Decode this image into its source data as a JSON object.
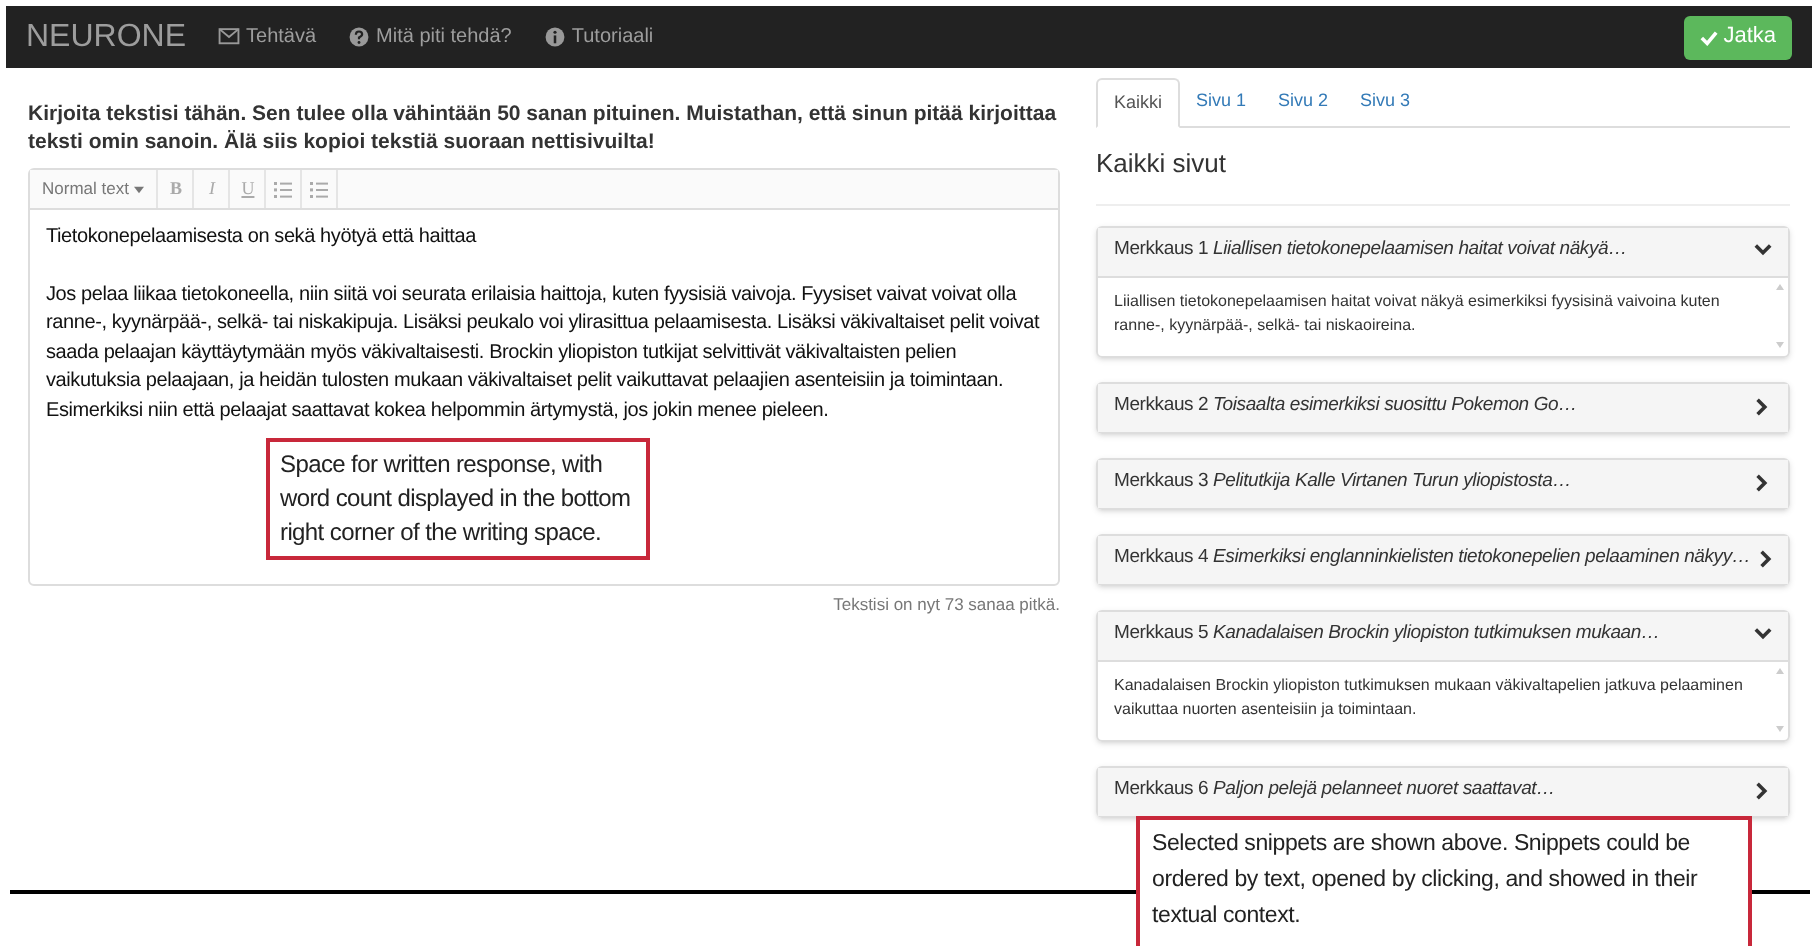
{
  "navbar": {
    "brand": "NEURONE",
    "links": [
      {
        "label": "Tehtävä"
      },
      {
        "label": "Mitä piti tehdä?"
      },
      {
        "label": "Tutoriaali"
      }
    ],
    "continue_button": "Jatka"
  },
  "instructions": "Kirjoita tekstisi tähän. Sen tulee olla vähintään 50 sanan pituinen. Muistathan, että sinun pitää kirjoittaa teksti omin sanoin. Älä siis kopioi tekstiä suoraan nettisivuilta!",
  "editor": {
    "toolbar": {
      "style_select": "Normal text",
      "buttons": [
        "B",
        "I",
        "U"
      ]
    },
    "paragraphs": [
      "Tietokonepelaamisesta on sekä hyötyä että haittaa",
      "Jos pelaa liikaa tietokoneella, niin siitä voi seurata erilaisia haittoja, kuten fyysisiä vaivoja. Fyysiset vaivat voivat olla ranne-, kyynärpää-, selkä- tai niskakipuja. Lisäksi peukalo voi ylirasittua pelaamisesta. Lisäksi väkivaltaiset pelit voivat saada pelaajan käyttäytymään myös väkivaltaisesti. Brockin yliopiston tutkijat selvittivät väkivaltaisten pelien vaikutuksia pelaajaan, ja heidän tulosten mukaan väkivaltaiset pelit vaikuttavat pelaajien asenteisiin ja toimintaan. Esimerkiksi niin että pelaajat saattavat kokea helpommin ärtymystä, jos jokin menee pieleen."
    ],
    "word_count": "Tekstisi on nyt 73 sanaa pitkä."
  },
  "callout_left": "Space for written response, with word count displayed in the bottom right corner of the writing space.",
  "tabs": [
    {
      "label": "Kaikki",
      "selected": true
    },
    {
      "label": "Sivu 1",
      "selected": false
    },
    {
      "label": "Sivu 2",
      "selected": false
    },
    {
      "label": "Sivu 3",
      "selected": false
    }
  ],
  "section_title": "Kaikki sivut",
  "snippets": [
    {
      "label": "Merkkaus 1",
      "title": "Liiallisen tietokonepelaamisen haitat voivat näkyä…",
      "expanded": true,
      "body": "Liiallisen tietokonepelaamisen haitat voivat näkyä esimerkiksi fyysisinä vaivoina kuten ranne-, kyynärpää-, selkä- tai niskaoireina."
    },
    {
      "label": "Merkkaus 2",
      "title": "Toisaalta esimerkiksi suosittu Pokemon Go…",
      "expanded": false
    },
    {
      "label": "Merkkaus 3",
      "title": "Pelitutkija Kalle Virtanen Turun yliopistosta…",
      "expanded": false
    },
    {
      "label": "Merkkaus 4",
      "title": "Esimerkiksi englanninkielisten tietokonepelien pelaaminen näkyy…",
      "expanded": false
    },
    {
      "label": "Merkkaus 5",
      "title": "Kanadalaisen Brockin yliopiston tutkimuksen mukaan…",
      "expanded": true,
      "body": "Kanadalaisen Brockin yliopiston tutkimuksen mukaan väkivaltapelien jatkuva pelaaminen vaikuttaa nuorten asenteisiin ja toimintaan."
    },
    {
      "label": "Merkkaus 6",
      "title": "Paljon pelejä pelanneet nuoret saattavat…",
      "expanded": false
    }
  ],
  "callout_right": "Selected snippets are shown above. Snippets could be ordered by text, opened by clicking, and showed in their textual context."
}
